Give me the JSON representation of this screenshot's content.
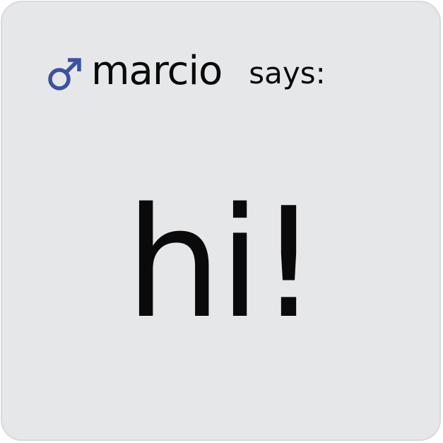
{
  "post": {
    "gender_icon": "male-symbol-icon",
    "username": "marcio",
    "says_label": "says:",
    "message": "hi!"
  },
  "colors": {
    "card_background": "#e6e7e9",
    "icon": "#3a52a4",
    "text": "#0a0a0a"
  }
}
